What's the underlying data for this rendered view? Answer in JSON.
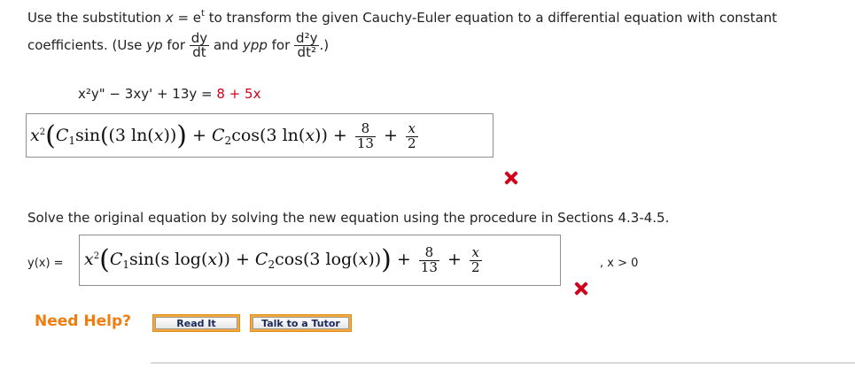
{
  "problem": {
    "line1_prefix": "Use the substitution ",
    "line1_var": "x",
    "line1_eq": " = e",
    "line1_sup": "t",
    "line1_suffix": " to transform the given Cauchy-Euler equation to a differential equation with constant",
    "line2_prefix": "coefficients. (Use ",
    "yp": "yp",
    "line2_for1": " for ",
    "frac1_num": "dy",
    "frac1_den": "dt",
    "line2_and": " and ",
    "ypp": "ypp",
    "line2_for2": " for ",
    "frac2_num": "d²y",
    "frac2_den": "dt²",
    "line2_close": ".)",
    "equation_lhs": "x²y\" − 3xy' + 13y = ",
    "equation_rhs": "8 + 5x"
  },
  "answer1": {
    "x": "x",
    "x_sup": "2",
    "open": "(",
    "c1": "C",
    "c1_sub": "1",
    "sin": "sin",
    "arg1": "(3 ln(",
    "arg1_x": "x",
    "arg1_close": "))",
    "close": ")",
    "plus1": " + ",
    "c2": "C",
    "c2_sub": "2",
    "cos": "cos",
    "arg2": "(3 ln(",
    "arg2_x": "x",
    "arg2_close": "))",
    "plus2": " + ",
    "f1_num": "8",
    "f1_den": "13",
    "plus3": " + ",
    "f2_num": "x",
    "f2_den": "2",
    "status": "incorrect"
  },
  "part2": {
    "instruction": "Solve the original equation by solving the new equation using the procedure in Sections 4.3-4.5.",
    "label": "y(x) = ",
    "domain": ", x > 0"
  },
  "answer2": {
    "x": "x",
    "x_sup": "2",
    "open": "(",
    "c1": "C",
    "c1_sub": "1",
    "sin": "sin",
    "arg1": "(s log(",
    "arg1_x": "x",
    "arg1_close": "))",
    "plus1": " + ",
    "c2": "C",
    "c2_sub": "2",
    "cos": "cos",
    "arg2": "(3 log(",
    "arg2_x": "x",
    "arg2_close": "))",
    "close": ")",
    "plus2": " + ",
    "f1_num": "8",
    "f1_den": "13",
    "plus3": " + ",
    "f2_num": "x",
    "f2_den": "2",
    "status": "incorrect"
  },
  "help": {
    "title": "Need Help?",
    "read_it": "Read It",
    "talk_tutor": "Talk to a Tutor"
  },
  "colors": {
    "incorrect": "#d0021b",
    "help": "#ef7d0f",
    "button_border": "#f6a93b"
  },
  "icons": {
    "incorrect_mark": "x-mark-icon"
  }
}
